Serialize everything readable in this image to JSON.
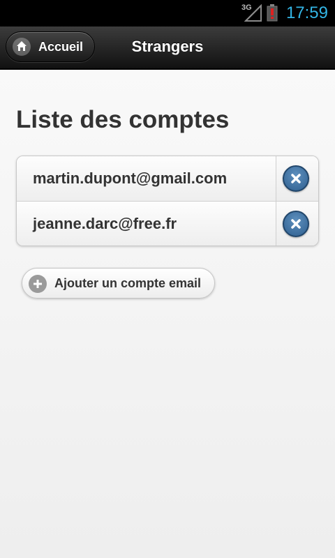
{
  "status_bar": {
    "network": "3G",
    "time": "17:59",
    "time_color": "#33b5e5",
    "battery_state": "alert"
  },
  "header": {
    "home_button_label": "Accueil",
    "title": "Strangers"
  },
  "main": {
    "title": "Liste des comptes",
    "accounts": [
      {
        "email": "martin.dupont@gmail.com"
      },
      {
        "email": "jeanne.darc@free.fr"
      }
    ],
    "add_button_label": "Ajouter un compte email"
  },
  "icons": {
    "home": "home-icon",
    "delete": "delete-icon",
    "add": "plus-icon",
    "signal": "signal-icon",
    "battery": "battery-icon"
  },
  "colors": {
    "accent": "#33b5e5",
    "delete_button": "#3a6c9c",
    "header_bg": "#1a1a1a"
  }
}
